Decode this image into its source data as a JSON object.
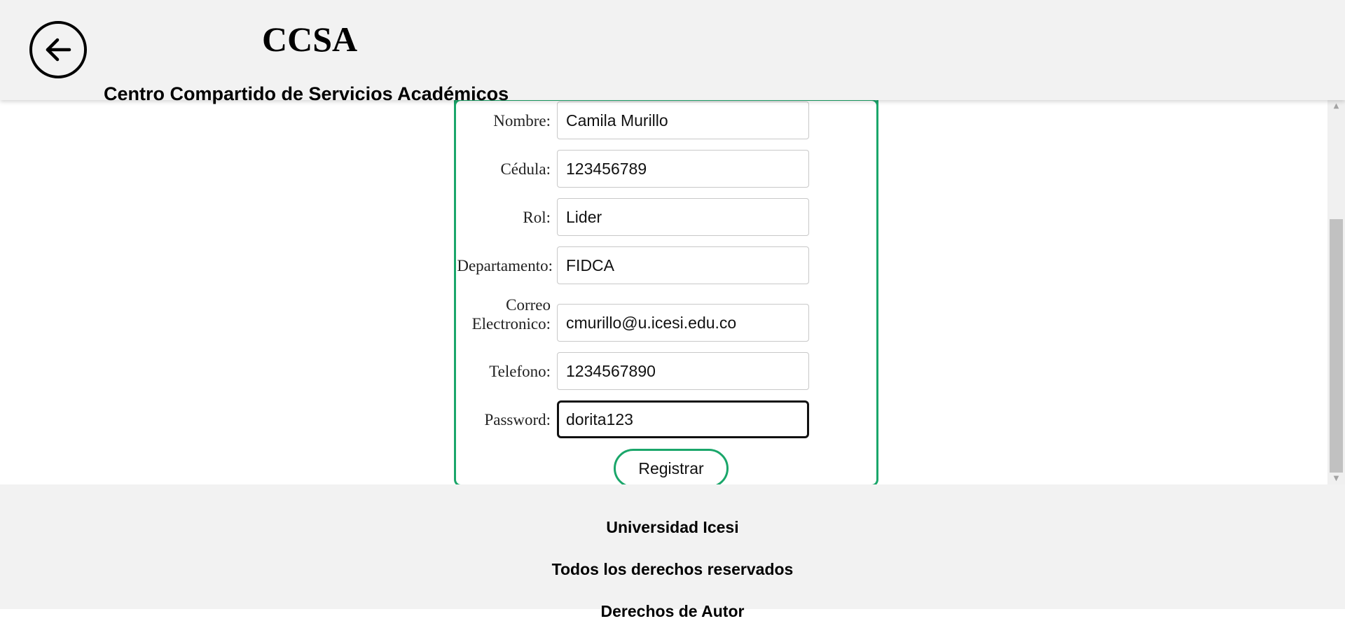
{
  "header": {
    "back_icon": "arrow-left-icon",
    "title": "CCSA",
    "subtitle": "Centro Compartido de Servicios Académicos"
  },
  "form": {
    "fields": [
      {
        "label": "Nombre:",
        "value": "Camila Murillo"
      },
      {
        "label": "Cédula:",
        "value": "123456789"
      },
      {
        "label": "Rol:",
        "value": "Lider"
      },
      {
        "label": "Departamento:",
        "value": "FIDCA"
      },
      {
        "label_line1": "Correo",
        "label_line2": "Electronico:",
        "value": "cmurillo@u.icesi.edu.co"
      },
      {
        "label": "Telefono:",
        "value": "1234567890"
      },
      {
        "label": "Password:",
        "value": "dorita123"
      }
    ],
    "submit_label": "Registrar"
  },
  "footer": {
    "line1": "Universidad Icesi",
    "line2": "Todos los derechos reservados",
    "line3": "Derechos de Autor"
  },
  "colors": {
    "accent": "#1aa66a",
    "header_bg": "#f2f2f2",
    "footer_bg": "#f2f2f2"
  }
}
